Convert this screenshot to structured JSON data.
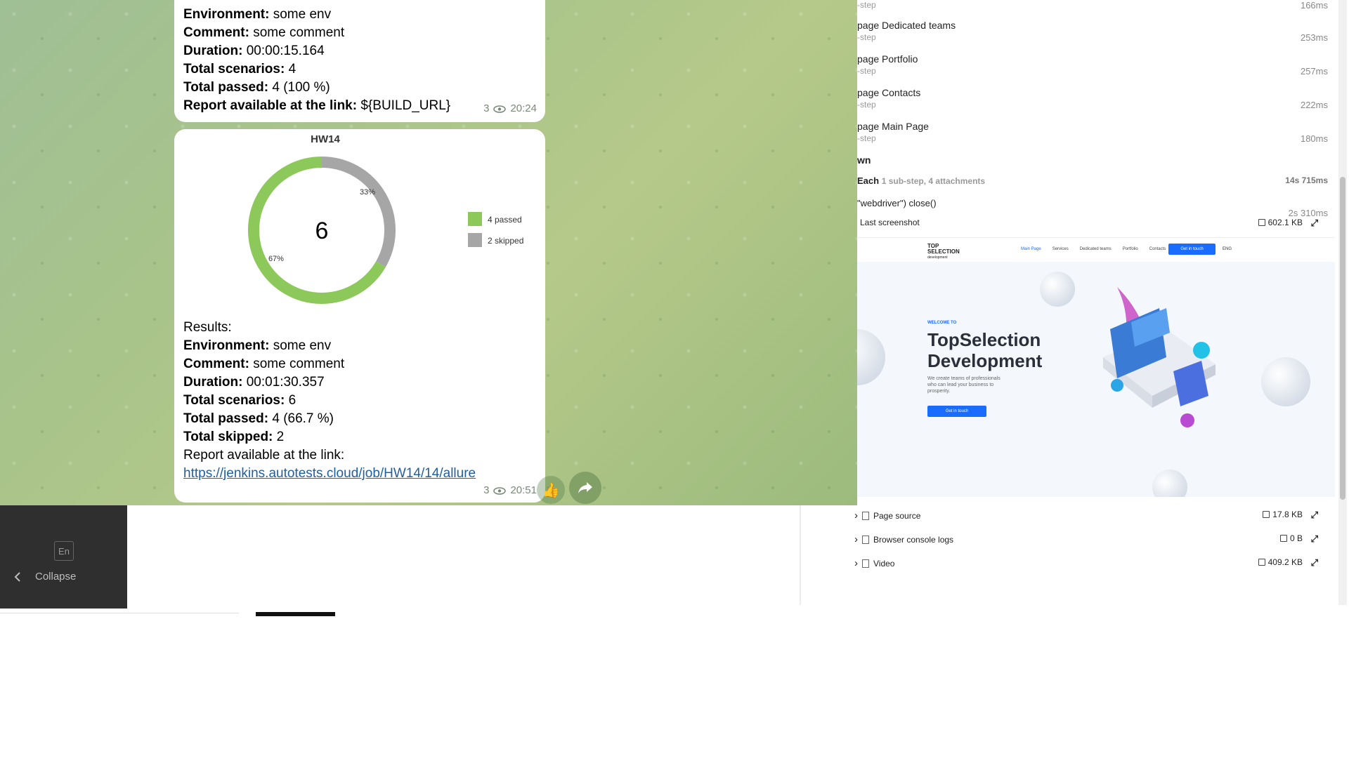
{
  "telegram": {
    "message1": {
      "lines": [
        {
          "label": "Environment:",
          "value": "some env"
        },
        {
          "label": "Comment:",
          "value": "some comment"
        },
        {
          "label": "Duration:",
          "value": "00:00:15.164"
        },
        {
          "label": "Total scenarios:",
          "value": "4"
        },
        {
          "label": "Total passed:",
          "value": "4 (100 %)"
        },
        {
          "label": "Report available at the link:",
          "value": "${BUILD_URL}"
        }
      ],
      "views": "3",
      "time": "20:24"
    },
    "message2": {
      "chart_title": "HW14",
      "results_heading": "Results:",
      "lines": [
        {
          "label": "Environment:",
          "value": "some env"
        },
        {
          "label": "Comment:",
          "value": "some comment"
        },
        {
          "label": "Duration:",
          "value": "00:01:30.357"
        },
        {
          "label": "Total scenarios:",
          "value": "6"
        },
        {
          "label": "Total passed:",
          "value": "4 (66.7 %)"
        },
        {
          "label": "Total skipped:",
          "value": "2"
        }
      ],
      "link_label": "Report available at the link:",
      "link_url": "https://jenkins.autotests.cloud/job/HW14/14/allure",
      "views": "3",
      "time": "20:51"
    },
    "reaction_emoji": "👍"
  },
  "chart_data": {
    "type": "pie",
    "title": "HW14",
    "center_label": "6",
    "slices": [
      {
        "label": "4 passed",
        "value": 4,
        "percent_label": "67%",
        "color": "#8dc85a"
      },
      {
        "label": "2 skipped",
        "value": 2,
        "percent_label": "33%",
        "color": "#a6a6a6"
      }
    ],
    "legend_placement": "right"
  },
  "sidebar": {
    "lang": "En",
    "collapse_label": "Collapse"
  },
  "allure": {
    "steps": [
      {
        "name": "",
        "sub": "-step",
        "time": "166ms"
      },
      {
        "name": "page Dedicated teams",
        "sub": "-step",
        "time": "253ms"
      },
      {
        "name": "page Portfolio",
        "sub": "-step",
        "time": "257ms"
      },
      {
        "name": "page Contacts",
        "sub": "-step",
        "time": "222ms"
      },
      {
        "name": "page Main Page",
        "sub": "-step",
        "time": "180ms"
      }
    ],
    "teardown_label": "wn",
    "after_each": {
      "name": "Each",
      "detail": "1 sub-step, 4 attachments",
      "time": "14s 715ms"
    },
    "close_step": {
      "name": "\"webdriver\") close()",
      "time": "2s 310ms"
    },
    "last_screenshot": {
      "label": "Last screenshot",
      "size": "602.1 KB"
    },
    "attachments": [
      {
        "label": "Page source",
        "size": "17.8 KB"
      },
      {
        "label": "Browser console logs",
        "size": "0 B"
      },
      {
        "label": "Video",
        "size": "409.2 KB"
      }
    ]
  },
  "preview": {
    "logo_line1": "TOP",
    "logo_line2": "SELECTION",
    "logo_line3": "development",
    "nav": [
      "Main Page",
      "Services",
      "Dedicated teams",
      "Portfolio",
      "Contacts"
    ],
    "nav_button": "Get in touch",
    "lang": "ENG",
    "welcome": "WELCOME TO",
    "title_line1": "TopSelection",
    "title_line2": "Development",
    "description": "We create teams of professionals who can lead your business to prosperity.",
    "hero_button": "Get in touch"
  }
}
